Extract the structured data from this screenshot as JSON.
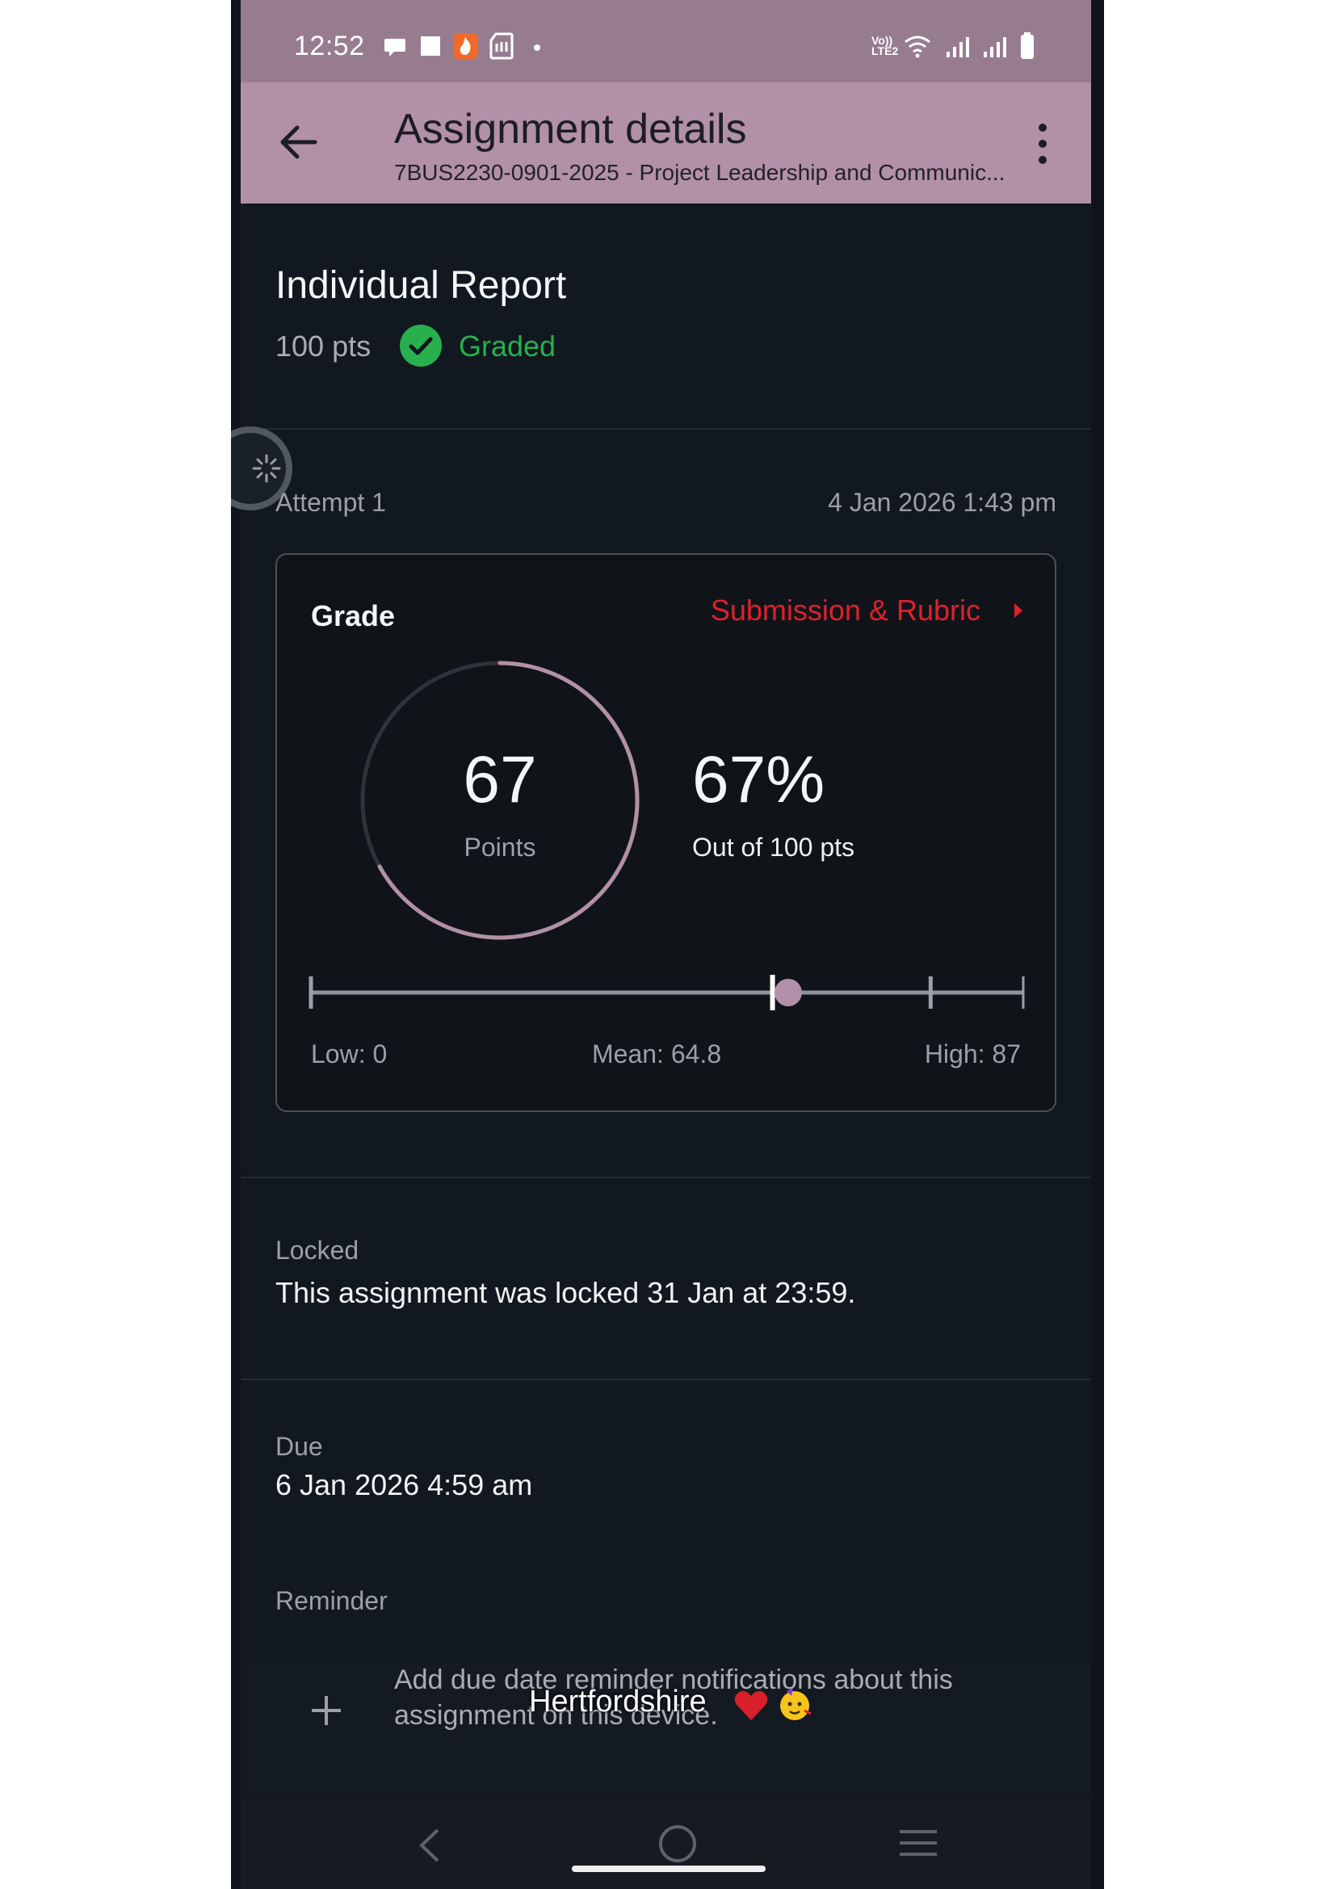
{
  "status_bar": {
    "time": "12:52",
    "left_icons": [
      "chat-bubble-icon",
      "square-icon",
      "flame-app-icon",
      "sd-card-icon",
      "dot-icon"
    ],
    "right_icons": [
      "volte-icon",
      "wifi-icon",
      "signal-1-icon",
      "signal-2-icon",
      "battery-icon"
    ],
    "volte_text": "Vo)) LTE2"
  },
  "app_bar": {
    "title": "Assignment details",
    "subtitle": "7BUS2230-0901-2025 - Project Leadership and Communic...",
    "background": "#b290a8"
  },
  "assignment": {
    "title": "Individual Report",
    "points_possible": "100 pts",
    "status": "Graded",
    "status_color": "#27b04d"
  },
  "attempt": {
    "label": "Attempt 1",
    "date": "4 Jan 2026 1:43 pm"
  },
  "grade_card": {
    "heading": "Grade",
    "link_label": "Submission & Rubric",
    "link_color": "#e0202c",
    "score": "67",
    "score_label": "Points",
    "score_fraction": 0.67,
    "percent": "67%",
    "out_of": "Out of 100 pts",
    "ring_color": "#b290a8",
    "distribution": {
      "low": 0,
      "mean": 64.8,
      "high": 87,
      "max": 100,
      "score": 67,
      "low_label": "Low: 0",
      "mean_label": "Mean: 64.8",
      "high_label": "High: 87"
    }
  },
  "locked": {
    "label": "Locked",
    "message": "This assignment was locked 31 Jan at 23:59."
  },
  "due": {
    "label": "Due",
    "date": "6 Jan 2026 4:59 am"
  },
  "reminder": {
    "label": "Reminder",
    "add_text": "Add due date reminder notifications about this assignment on this device."
  },
  "caption_overlay": "Hertfordshire",
  "nav_bar": {
    "icons": [
      "nav-back-icon",
      "nav-home-icon",
      "nav-recents-icon"
    ]
  }
}
